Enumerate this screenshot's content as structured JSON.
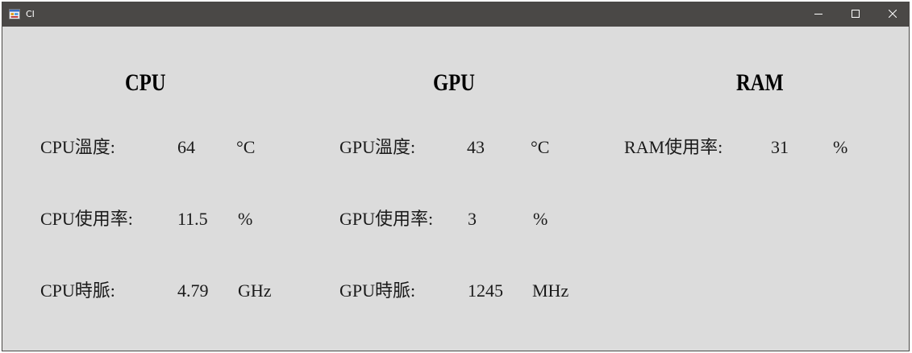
{
  "window": {
    "title": "CI",
    "icon": "app-window-icon",
    "controls": {
      "minimize_icon": "minimize-icon",
      "maximize_icon": "maximize-icon",
      "close_icon": "close-icon"
    }
  },
  "cpu": {
    "heading": "CPU",
    "temp_label": "CPU溫度:",
    "temp_value": "64",
    "temp_unit": "°C",
    "usage_label": "CPU使用率:",
    "usage_value": "11.5",
    "usage_unit": "%",
    "clock_label": "CPU時脈:",
    "clock_value": "4.79",
    "clock_unit": "GHz"
  },
  "gpu": {
    "heading": "GPU",
    "temp_label": "GPU溫度:",
    "temp_value": "43",
    "temp_unit": "°C",
    "usage_label": "GPU使用率:",
    "usage_value": "3",
    "usage_unit": "%",
    "clock_label": "GPU時脈:",
    "clock_value": "1245",
    "clock_unit": "MHz"
  },
  "ram": {
    "heading": "RAM",
    "usage_label": "RAM使用率:",
    "usage_value": "31",
    "usage_unit": "%"
  },
  "colors": {
    "titlebar": "#4a4846",
    "client_background": "#dcdcdc",
    "text": "#1a1a1a"
  }
}
